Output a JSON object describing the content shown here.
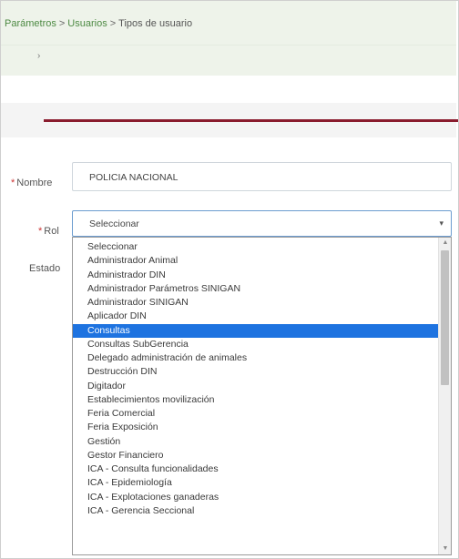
{
  "breadcrumb": {
    "items": [
      "Parámetros",
      "Usuarios"
    ],
    "separator": ">",
    "current": "Tipos de usuario"
  },
  "subbar": {
    "arrow": "›"
  },
  "form": {
    "nombre": {
      "label": "Nombre",
      "required_mark": "*",
      "value": "POLICIA NACIONAL"
    },
    "rol": {
      "label": "Rol",
      "required_mark": "*",
      "selected": "Seleccionar",
      "caret": "▾",
      "options": [
        "Seleccionar",
        "Administrador Animal",
        "Administrador DIN",
        "Administrador Parámetros SINIGAN",
        "Administrador SINIGAN",
        "Aplicador DIN",
        "Consultas",
        "Consultas SubGerencia",
        "Delegado administración de animales",
        "Destrucción DIN",
        "Digitador",
        "Establecimientos movilización",
        "Feria Comercial",
        "Feria Exposición",
        "Gestión",
        "Gestor Financiero",
        "ICA - Consulta funcionalidades",
        "ICA - Epidemiología",
        "ICA - Explotaciones ganaderas",
        "ICA - Gerencia Seccional"
      ],
      "highlighted_option": "Consultas"
    },
    "estado": {
      "label": "Estado"
    }
  },
  "scrollbar": {
    "up": "▲",
    "down": "▼"
  },
  "colors": {
    "accent_line": "#8a1c2e",
    "highlight": "#1e73e0",
    "link": "#4d8a43"
  }
}
